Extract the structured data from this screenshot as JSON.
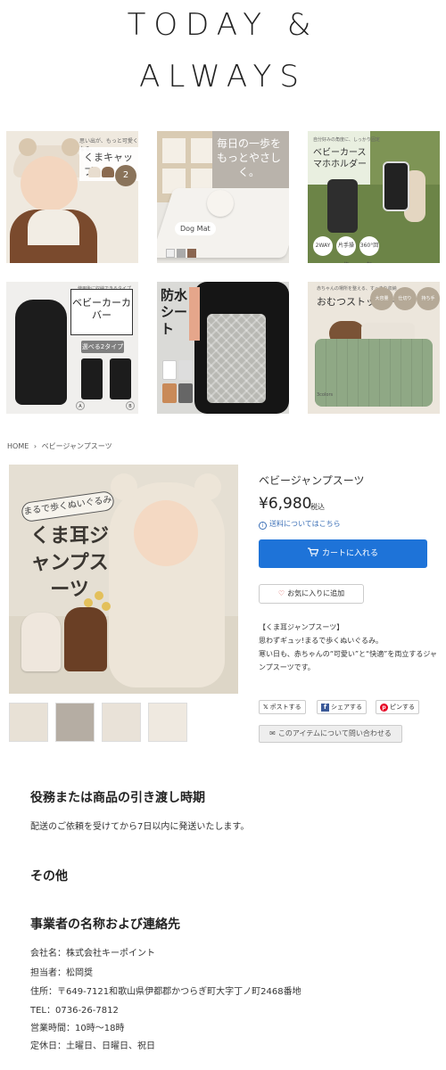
{
  "logo": {
    "line1": "TODAY &",
    "line2": "ALWAYS"
  },
  "banners": [
    {
      "caption": "くまキャップ",
      "sub": "思い出が、もっと可愛くなる。",
      "badge": "2"
    },
    {
      "caption": "毎日の一歩をもっとやさしく。",
      "tag": "Dog Mat"
    },
    {
      "caption": "ベビーカースマホホルダー",
      "sub": "自分好みの角度に、しっかり固定",
      "icons": [
        "2WAY",
        "片手操作",
        "360°回転"
      ]
    },
    {
      "caption": "ベビーカーカバー",
      "sub": "使用後に収納できるタイプ",
      "pill": "選べる2タイプ",
      "labels": [
        "A",
        "B"
      ]
    },
    {
      "caption": "防水シート",
      "band": "しっかり守るロングタイプ"
    },
    {
      "caption": "おむつストッカー",
      "sub": "赤ちゃんの場所を整える、すっきり収納",
      "circles": [
        "大容量",
        "仕切り",
        "持ち手"
      ],
      "colors": "3colors"
    }
  ],
  "breadcrumb": {
    "home": "HOME",
    "sep": "›",
    "current": "ベビージャンプスーツ"
  },
  "product": {
    "name": "ベビージャンプスーツ",
    "price": "¥6,980",
    "tax": "税込",
    "shipping_link": "送料についてはこちら",
    "cart_button": "カートに入れる",
    "favorite_button": "お気に入りに追加",
    "image_label": "まるで歩くぬいぐるみ",
    "image_title": "くま耳ジャンプスーツ",
    "description": [
      "【くま耳ジャンプスーツ】",
      "思わずギュッ!まるで歩くぬいぐるみ。",
      "寒い日も、赤ちゃんの“可愛い”と“快適”を両立するジャンプスーツです。"
    ],
    "share": {
      "post": "ポストする",
      "share": "シェアする",
      "pin": "ピンする"
    },
    "inquiry_button": "このアイテムについて問い合わせる"
  },
  "sections": {
    "delivery_title": "役務または商品の引き渡し時期",
    "delivery_text": "配送のご依頼を受けてから7日以内に発送いたします。",
    "other_title": "その他",
    "company_title": "事業者の名称および連絡先",
    "company_lines": [
      "会社名：株式会社キーポイント",
      "担当者：松岡奨",
      "住所：〒649-7121和歌山県伊都郡かつらぎ町大字丁ノ町2468番地",
      "TEL：0736-26-7812",
      "営業時間：10時〜18時",
      "定休日：土曜日、日曜日、祝日"
    ]
  },
  "colors": {
    "accent": "#1e73d8",
    "link": "#3b6fb6",
    "heart": "#d9534f"
  }
}
